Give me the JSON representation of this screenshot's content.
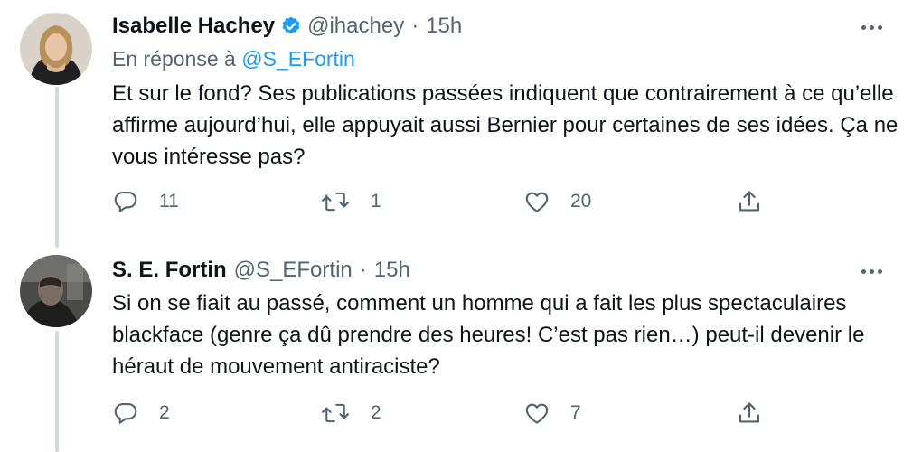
{
  "tweets": [
    {
      "name": "Isabelle Hachey",
      "handle": "@ihachey",
      "dot": "·",
      "time": "15h",
      "reply_prefix": "En réponse à",
      "reply_handle": "@S_EFortin",
      "text": "Et sur le fond? Ses publications passées indiquent que contrairement à ce qu’elle affirme aujourd’hui, elle appuyait aussi Bernier pour certaines de ses idées. Ça ne vous intéresse pas?",
      "replies": "11",
      "retweets": "1",
      "likes": "20",
      "verified": true
    },
    {
      "name": "S. E. Fortin",
      "handle": "@S_EFortin",
      "dot": "·",
      "time": "15h",
      "text": "Si on se fiait au passé, comment un homme qui a fait les plus spectaculaires blackface (genre ça dû prendre des heures! C’est pas rien…) peut-il devenir le héraut de mouvement antiraciste?",
      "replies": "2",
      "retweets": "2",
      "likes": "7",
      "verified": false
    }
  ],
  "colors": {
    "accent": "#1d9bf0",
    "secondary_text": "#536471",
    "thread_line": "#cfd9de"
  },
  "icons": [
    "verified-badge-icon",
    "more-icon",
    "reply-icon",
    "retweet-icon",
    "like-icon",
    "share-icon"
  ]
}
